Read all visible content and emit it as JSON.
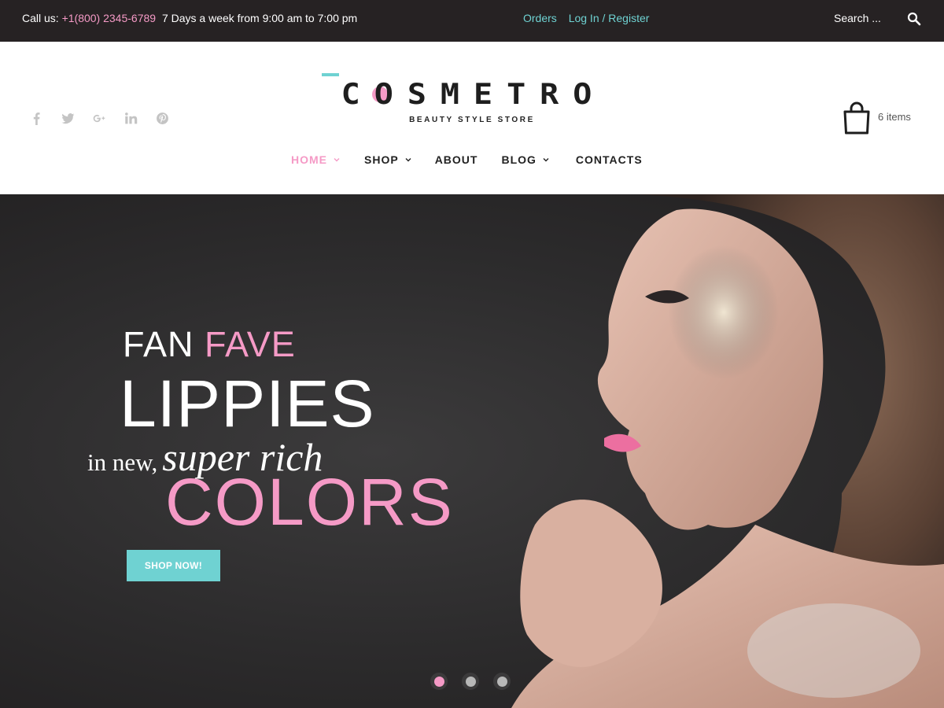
{
  "topbar": {
    "call_label": "Call us:",
    "phone": "+1(800) 2345-6789",
    "hours": "7 Days a week from 9:00 am to 7:00 pm",
    "links": [
      "Orders",
      "Log In / Register"
    ],
    "search_placeholder": "Search ..."
  },
  "header": {
    "social_icons": [
      "facebook-icon",
      "twitter-icon",
      "google-plus-icon",
      "linkedin-icon",
      "pinterest-icon"
    ],
    "logo": {
      "brand": "COSMETRO",
      "tagline": "BEAUTY STYLE STORE"
    },
    "cart": {
      "count_label": "6 items"
    },
    "nav": [
      {
        "label": "HOME",
        "dropdown": true,
        "active": true
      },
      {
        "label": "SHOP",
        "dropdown": true
      },
      {
        "label": "ABOUT",
        "dropdown": false
      },
      {
        "label": "BLOG",
        "dropdown": true
      },
      {
        "label": "CONTACTS",
        "dropdown": false
      }
    ]
  },
  "hero": {
    "line1_white": "FAN",
    "line1_pink": "FAVE",
    "line2": "LIPPIES",
    "line3_plain": "in new,",
    "line3_script": "super rich",
    "line4": "COLORS",
    "button": "SHOP NOW!",
    "slides": 3,
    "active_slide": 1
  },
  "colors": {
    "topbar_bg": "#262223",
    "accent_pink": "#f59ac6",
    "accent_teal": "#6fd2d2",
    "hero_bg": "#2c2b2c"
  }
}
